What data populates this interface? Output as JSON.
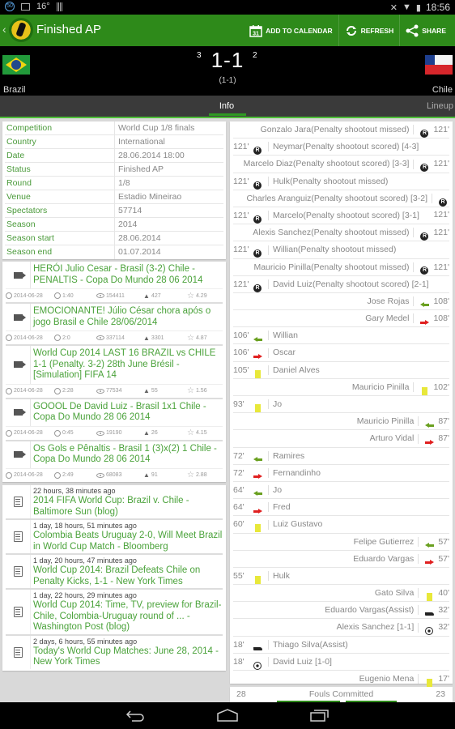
{
  "status_bar": {
    "notification_badge": "50",
    "temperature": "16°",
    "time": "18:56"
  },
  "action_bar": {
    "title": "Finished AP",
    "actions": [
      {
        "label": "ADD TO CALENDAR",
        "icon": "calendar-icon",
        "calendar_day": "31"
      },
      {
        "label": "REFRESH",
        "icon": "refresh-icon"
      },
      {
        "label": "SHARE",
        "icon": "share-icon"
      }
    ]
  },
  "match": {
    "home_team": "Brazil",
    "away_team": "Chile",
    "score": "1-1",
    "home_penalties": "3",
    "away_penalties": "2",
    "halftime_score": "(1-1)"
  },
  "tabs": [
    {
      "label": "Info",
      "active": true
    },
    {
      "label": "Lineup",
      "active": false
    }
  ],
  "info": [
    {
      "key": "Competition",
      "value": "World Cup 1/8 finals"
    },
    {
      "key": "Country",
      "value": "International"
    },
    {
      "key": "Date",
      "value": "28.06.2014 18:00"
    },
    {
      "key": "Status",
      "value": "Finished AP"
    },
    {
      "key": "Round",
      "value": "1/8"
    },
    {
      "key": "Venue",
      "value": "Estadio Mineirao"
    },
    {
      "key": "Spectators",
      "value": "57714"
    },
    {
      "key": "Season",
      "value": "2014"
    },
    {
      "key": "Season start",
      "value": "28.06.2014"
    },
    {
      "key": "Season end",
      "value": "01.07.2014"
    }
  ],
  "videos": [
    {
      "title": "HERÓI Julio Cesar - Brasil (3-2) Chile - PENALTIS - Copa Do Mundo 28 06 2014",
      "date": "2014-06-28",
      "duration": "1:40",
      "views": "154411",
      "likes": "427",
      "rating": "4.29"
    },
    {
      "title": "EMOCIONANTE! Júlio César chora após o jogo Brasil e Chile 28/06/2014",
      "date": "2014-06-28",
      "duration": "2:0",
      "views": "337114",
      "likes": "3301",
      "rating": "4.87"
    },
    {
      "title": "World Cup 2014 LAST 16 BRAZIL vs CHILE 1-1 (Penalty. 3-2) 28th June Brésil - [Simulation] FIFA 14",
      "date": "2014-06-28",
      "duration": "2:28",
      "views": "77534",
      "likes": "55",
      "rating": "1.56"
    },
    {
      "title": "GOOOL De David Luiz - Brasil 1x1 Chile - Copa Do Mundo 28 06 2014",
      "date": "2014-06-28",
      "duration": "0:45",
      "views": "19190",
      "likes": "26",
      "rating": "4.15"
    },
    {
      "title": "Os Gols e Pênaltis - Brasil 1 (3)x(2) 1 Chile - Copa Do Mundo 28 06 2014",
      "date": "2014-06-28",
      "duration": "2:49",
      "views": "68083",
      "likes": "91",
      "rating": "2.88"
    }
  ],
  "news": [
    {
      "time": "22 hours, 38 minutes ago",
      "title": "2014 FIFA World Cup: Brazil v. Chile - Baltimore Sun (blog)"
    },
    {
      "time": "1 day, 18 hours, 51 minutes ago",
      "title": "Colombia Beats Uruguay 2-0, Will Meet Brazil in World Cup Match - Bloomberg"
    },
    {
      "time": "1 day, 20 hours, 47 minutes ago",
      "title": "World Cup 2014: Brazil Defeats Chile on Penalty Kicks, 1-1 - New York Times"
    },
    {
      "time": "1 day, 22 hours, 29 minutes ago",
      "title": "World Cup 2014: Time, TV, preview for Brazil-Chile, Colombia-Uruguay round of ... - Washington Post (blog)"
    },
    {
      "time": "2 days, 6 hours, 55 minutes ago",
      "title": "Today's World Cup Matches: June 28, 2014 - New York Times"
    }
  ],
  "events": [
    {
      "side": "away",
      "minute": "121'",
      "type": "penalty",
      "text": "Gonzalo Jara(Penalty shootout missed)"
    },
    {
      "side": "home",
      "minute": "121'",
      "type": "penalty",
      "text": "Neymar(Penalty shootout scored) [4-3]"
    },
    {
      "side": "away",
      "minute": "121'",
      "type": "penalty",
      "text": "Marcelo Diaz(Penalty shootout scored) [3-3]"
    },
    {
      "side": "home",
      "minute": "121'",
      "type": "penalty",
      "text": "Hulk(Penalty shootout missed)"
    },
    {
      "side": "away",
      "minute": "121'",
      "type": "penalty",
      "text": "Charles Aranguiz(Penalty shootout scored) [3-2]"
    },
    {
      "side": "home",
      "minute": "121'",
      "type": "penalty",
      "text": "Marcelo(Penalty shootout scored) [3-1]"
    },
    {
      "side": "away",
      "minute": "121'",
      "type": "penalty",
      "text": "Alexis Sanchez(Penalty shootout missed)"
    },
    {
      "side": "home",
      "minute": "121'",
      "type": "penalty",
      "text": "Willian(Penalty shootout missed)"
    },
    {
      "side": "away",
      "minute": "121'",
      "type": "penalty",
      "text": "Mauricio Pinilla(Penalty shootout missed)"
    },
    {
      "side": "home",
      "minute": "121'",
      "type": "penalty",
      "text": "David Luiz(Penalty shootout scored) [2-1]"
    },
    {
      "side": "away",
      "minute": "108'",
      "type": "sub-in",
      "text": "Jose Rojas"
    },
    {
      "side": "away",
      "minute": "108'",
      "type": "sub-out",
      "text": "Gary Medel"
    },
    {
      "side": "home",
      "minute": "106'",
      "type": "sub-in",
      "text": "Willian"
    },
    {
      "side": "home",
      "minute": "106'",
      "type": "sub-out",
      "text": "Oscar"
    },
    {
      "side": "home",
      "minute": "105'",
      "type": "yellow-card",
      "text": "Daniel Alves"
    },
    {
      "side": "away",
      "minute": "102'",
      "type": "yellow-card",
      "text": "Mauricio Pinilla"
    },
    {
      "side": "home",
      "minute": "93'",
      "type": "yellow-card",
      "text": "Jo"
    },
    {
      "side": "away",
      "minute": "87'",
      "type": "sub-in",
      "text": "Mauricio Pinilla"
    },
    {
      "side": "away",
      "minute": "87'",
      "type": "sub-out",
      "text": "Arturo Vidal"
    },
    {
      "side": "home",
      "minute": "72'",
      "type": "sub-in",
      "text": "Ramires"
    },
    {
      "side": "home",
      "minute": "72'",
      "type": "sub-out",
      "text": "Fernandinho"
    },
    {
      "side": "home",
      "minute": "64'",
      "type": "sub-in",
      "text": "Jo"
    },
    {
      "side": "home",
      "minute": "64'",
      "type": "sub-out",
      "text": "Fred"
    },
    {
      "side": "home",
      "minute": "60'",
      "type": "yellow-card",
      "text": "Luiz Gustavo"
    },
    {
      "side": "away",
      "minute": "57'",
      "type": "sub-in",
      "text": "Felipe Gutierrez"
    },
    {
      "side": "away",
      "minute": "57'",
      "type": "sub-out",
      "text": "Eduardo Vargas"
    },
    {
      "side": "home",
      "minute": "55'",
      "type": "yellow-card",
      "text": "Hulk"
    },
    {
      "side": "away",
      "minute": "40'",
      "type": "yellow-card",
      "text": "Gato Silva"
    },
    {
      "side": "away",
      "minute": "32'",
      "type": "assist",
      "text": "Eduardo Vargas(Assist)"
    },
    {
      "side": "away",
      "minute": "32'",
      "type": "goal",
      "text": "Alexis Sanchez [1-1]"
    },
    {
      "side": "home",
      "minute": "18'",
      "type": "assist",
      "text": "Thiago Silva(Assist)"
    },
    {
      "side": "home",
      "minute": "18'",
      "type": "goal",
      "text": "David Luiz [1-0]"
    },
    {
      "side": "away",
      "minute": "17'",
      "type": "yellow-card",
      "text": "Eugenio Mena"
    }
  ],
  "stats": [
    {
      "label": "Fouls Committed",
      "home": "28",
      "away": "23"
    }
  ],
  "colors": {
    "action_bar": "#2e8a1a",
    "link_green": "#4aa23a",
    "tab_indicator": "#2e9a22",
    "yellow_card": "#e8e83a",
    "sub_in": "#6aa020",
    "sub_out": "#e02020"
  }
}
